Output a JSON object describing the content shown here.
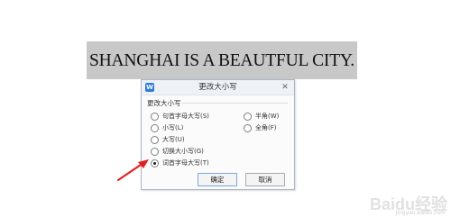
{
  "document": {
    "text": "SHANGHAI IS A BEAUTFUL CITY."
  },
  "dialog": {
    "app_icon": "W",
    "title": "更改大小写",
    "close_icon": "✕",
    "group_label": "更改大小写",
    "options_left": [
      {
        "label": "句首字母大写(S)",
        "checked": false
      },
      {
        "label": "小写(L)",
        "checked": false
      },
      {
        "label": "大写(U)",
        "checked": false
      },
      {
        "label": "切换大小写(G)",
        "checked": false
      },
      {
        "label": "词首字母大写(T)",
        "checked": true
      }
    ],
    "options_right": [
      {
        "label": "半角(W)",
        "checked": false
      },
      {
        "label": "全角(F)",
        "checked": false
      }
    ],
    "ok_label": "确定",
    "cancel_label": "取消"
  },
  "annotation": {
    "arrow_color": "#e02020"
  },
  "watermark": {
    "text": "Baidu经验",
    "sub": "jingyan.baidu.com"
  }
}
